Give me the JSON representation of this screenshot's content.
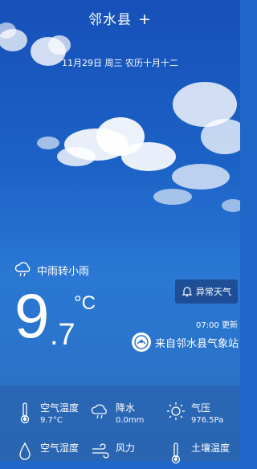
{
  "header": {
    "city": "邻水县",
    "add_symbol": "+"
  },
  "date": "11月29日 周三 农历十月十二",
  "weather": {
    "condition": "中雨转小雨",
    "temp_integer": "9",
    "temp_decimal": ".7",
    "temp_unit": "°C",
    "update_time": "07:00 更新",
    "source": "来自邻水县气象站"
  },
  "alert_button": {
    "label": "异常天气"
  },
  "details": [
    {
      "icon": "thermometer-icon",
      "label": "空气温度",
      "value": "9.7°C"
    },
    {
      "icon": "rain-cloud-icon",
      "label": "降水",
      "value": "0.0mm"
    },
    {
      "icon": "sun-icon",
      "label": "气压",
      "value": "976.5Pa"
    },
    {
      "icon": "humidity-drop-icon",
      "label": "空气湿度",
      "value": ""
    },
    {
      "icon": "wind-icon",
      "label": "风力",
      "value": ""
    },
    {
      "icon": "soil-thermometer-icon",
      "label": "土壤温度",
      "value": ""
    }
  ],
  "colors": {
    "sky_top": "#1650b8",
    "sky_bottom": "#2a6db8",
    "panel": "#285faa"
  }
}
